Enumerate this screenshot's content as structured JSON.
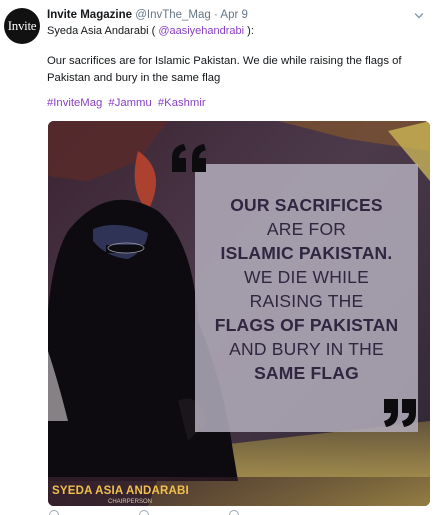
{
  "tweet": {
    "author_name": "Invite Magazine",
    "author_handle": "@InvThe_Mag",
    "separator": "·",
    "time": "Apr 9",
    "avatar_text": "Invite",
    "reply_prefix": "Syeda Asia Andarabi (",
    "reply_mention": "@aasiyehandrabi",
    "reply_suffix": "):",
    "text": "Our sacrifices are for Islamic Pakistan. We die while raising the flags of Pakistan and bury in the same flag",
    "hashtags": [
      "#InviteMag",
      "#Jammu",
      "#Kashmir"
    ]
  },
  "media": {
    "quote_lines": [
      {
        "text": "OUR SACRIFICES",
        "bold": true
      },
      {
        "text": "ARE FOR",
        "bold": false
      },
      {
        "text": "ISLAMIC PAKISTAN.",
        "bold": true
      },
      {
        "text": "WE DIE WHILE",
        "bold": false
      },
      {
        "text": "RAISING THE",
        "bold": false
      },
      {
        "text": "FLAGS OF PAKISTAN",
        "bold": true
      },
      {
        "text": "AND BURY IN THE",
        "bold": false
      },
      {
        "text": "SAME FLAG",
        "bold": true
      }
    ],
    "caption": "SYEDA ASIA ANDARABI",
    "caption_sub": "CHAIRPERSON",
    "colors": {
      "quote_text": "#2f2740",
      "caption_text": "#f2c04a",
      "hashtag": "#8a3fc4"
    }
  },
  "icons": {
    "more": "chevron-down-icon",
    "open_quote": "open-quote-icon",
    "close_quote": "close-quote-icon"
  }
}
